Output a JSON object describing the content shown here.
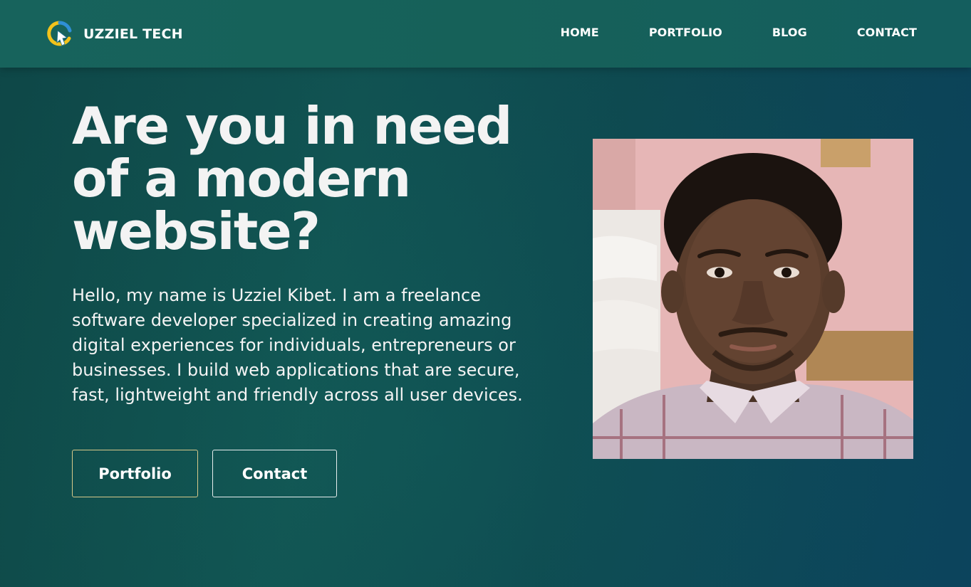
{
  "header": {
    "brand_name": "UZZIEL TECH",
    "logo_icon": "uzziel-tech-logo-icon",
    "nav": [
      {
        "label": "HOME"
      },
      {
        "label": "PORTFOLIO"
      },
      {
        "label": "BLOG"
      },
      {
        "label": "CONTACT"
      }
    ]
  },
  "hero": {
    "title": "Are you in need of a modern website?",
    "description": "Hello, my name is Uzziel Kibet. I am a freelance software developer specialized in creating amazing digital experiences for individuals, entrepreneurs or businesses. I build web applications that are secure, fast, lightweight and friendly across all user devices.",
    "buttons": {
      "portfolio_label": "Portfolio",
      "contact_label": "Contact"
    },
    "photo": "portrait-photo"
  },
  "colors": {
    "header_bg": "#17635c",
    "page_bg": "#125a56",
    "logo_yellow": "#f2c21b",
    "logo_blue": "#2f8fd6",
    "text": "#ffffff"
  }
}
